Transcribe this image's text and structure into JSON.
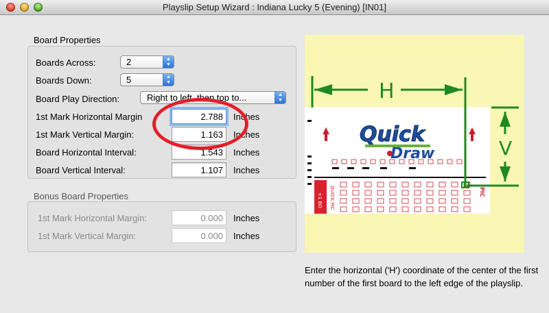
{
  "window": {
    "title": "Playslip Setup Wizard : Indiana Lucky 5 (Evening) [IN01]"
  },
  "board_properties": {
    "title": "Board Properties",
    "boards_across_label": "Boards Across:",
    "boards_across_value": "2",
    "boards_down_label": "Boards Down:",
    "boards_down_value": "5",
    "direction_label": "Board Play Direction:",
    "direction_value": "Right to left, then top to...",
    "h_margin_label": "1st Mark Horizontal Margin",
    "h_margin_value": "2.788",
    "v_margin_label": "1st Mark Vertical Margin:",
    "v_margin_value": "1.163",
    "h_interval_label": "Board Horizontal Interval:",
    "h_interval_value": "1.543",
    "v_interval_label": "Board Vertical Interval:",
    "v_interval_value": "1.107",
    "units": "Inches"
  },
  "bonus_properties": {
    "title": "Bonus Board Properties",
    "h_margin_label": "1st Mark Horizontal Margin:",
    "h_margin_value": "0.000",
    "v_margin_label": "1st Mark Vertical Margin:",
    "v_margin_value": "0.000",
    "units": "Inches"
  },
  "preview": {
    "h_label": "H",
    "v_label": "V",
    "logo_top": "Quick",
    "logo_bottom": "Draw",
    "side_left": "+1 BO",
    "quick_pick": "QUICK PIC",
    "side_right": "PIC"
  },
  "description": "Enter the horizontal ('H') coordinate of the center of the first number of the first board to the left edge of the playslip.",
  "colors": {
    "accent_green": "#1e8a1e",
    "highlight_red": "#e31e2a",
    "preview_bg": "#faf6b4"
  }
}
